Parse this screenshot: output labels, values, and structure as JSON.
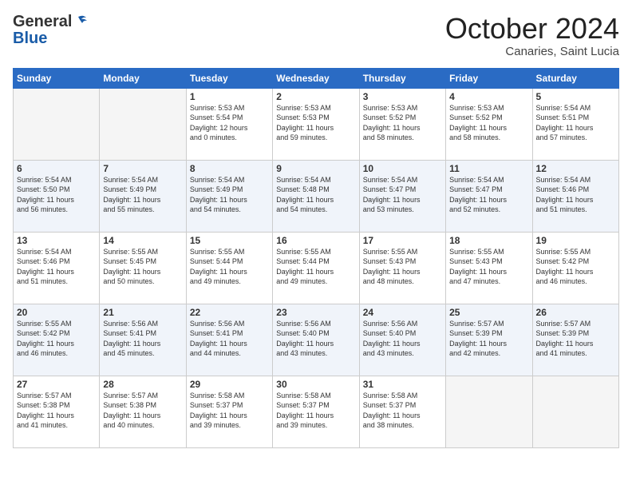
{
  "header": {
    "logo_general": "General",
    "logo_blue": "Blue",
    "month": "October 2024",
    "location": "Canaries, Saint Lucia"
  },
  "days_of_week": [
    "Sunday",
    "Monday",
    "Tuesday",
    "Wednesday",
    "Thursday",
    "Friday",
    "Saturday"
  ],
  "weeks": [
    [
      {
        "num": "",
        "info": ""
      },
      {
        "num": "",
        "info": ""
      },
      {
        "num": "1",
        "info": "Sunrise: 5:53 AM\nSunset: 5:54 PM\nDaylight: 12 hours\nand 0 minutes."
      },
      {
        "num": "2",
        "info": "Sunrise: 5:53 AM\nSunset: 5:53 PM\nDaylight: 11 hours\nand 59 minutes."
      },
      {
        "num": "3",
        "info": "Sunrise: 5:53 AM\nSunset: 5:52 PM\nDaylight: 11 hours\nand 58 minutes."
      },
      {
        "num": "4",
        "info": "Sunrise: 5:53 AM\nSunset: 5:52 PM\nDaylight: 11 hours\nand 58 minutes."
      },
      {
        "num": "5",
        "info": "Sunrise: 5:54 AM\nSunset: 5:51 PM\nDaylight: 11 hours\nand 57 minutes."
      }
    ],
    [
      {
        "num": "6",
        "info": "Sunrise: 5:54 AM\nSunset: 5:50 PM\nDaylight: 11 hours\nand 56 minutes."
      },
      {
        "num": "7",
        "info": "Sunrise: 5:54 AM\nSunset: 5:49 PM\nDaylight: 11 hours\nand 55 minutes."
      },
      {
        "num": "8",
        "info": "Sunrise: 5:54 AM\nSunset: 5:49 PM\nDaylight: 11 hours\nand 54 minutes."
      },
      {
        "num": "9",
        "info": "Sunrise: 5:54 AM\nSunset: 5:48 PM\nDaylight: 11 hours\nand 54 minutes."
      },
      {
        "num": "10",
        "info": "Sunrise: 5:54 AM\nSunset: 5:47 PM\nDaylight: 11 hours\nand 53 minutes."
      },
      {
        "num": "11",
        "info": "Sunrise: 5:54 AM\nSunset: 5:47 PM\nDaylight: 11 hours\nand 52 minutes."
      },
      {
        "num": "12",
        "info": "Sunrise: 5:54 AM\nSunset: 5:46 PM\nDaylight: 11 hours\nand 51 minutes."
      }
    ],
    [
      {
        "num": "13",
        "info": "Sunrise: 5:54 AM\nSunset: 5:46 PM\nDaylight: 11 hours\nand 51 minutes."
      },
      {
        "num": "14",
        "info": "Sunrise: 5:55 AM\nSunset: 5:45 PM\nDaylight: 11 hours\nand 50 minutes."
      },
      {
        "num": "15",
        "info": "Sunrise: 5:55 AM\nSunset: 5:44 PM\nDaylight: 11 hours\nand 49 minutes."
      },
      {
        "num": "16",
        "info": "Sunrise: 5:55 AM\nSunset: 5:44 PM\nDaylight: 11 hours\nand 49 minutes."
      },
      {
        "num": "17",
        "info": "Sunrise: 5:55 AM\nSunset: 5:43 PM\nDaylight: 11 hours\nand 48 minutes."
      },
      {
        "num": "18",
        "info": "Sunrise: 5:55 AM\nSunset: 5:43 PM\nDaylight: 11 hours\nand 47 minutes."
      },
      {
        "num": "19",
        "info": "Sunrise: 5:55 AM\nSunset: 5:42 PM\nDaylight: 11 hours\nand 46 minutes."
      }
    ],
    [
      {
        "num": "20",
        "info": "Sunrise: 5:55 AM\nSunset: 5:42 PM\nDaylight: 11 hours\nand 46 minutes."
      },
      {
        "num": "21",
        "info": "Sunrise: 5:56 AM\nSunset: 5:41 PM\nDaylight: 11 hours\nand 45 minutes."
      },
      {
        "num": "22",
        "info": "Sunrise: 5:56 AM\nSunset: 5:41 PM\nDaylight: 11 hours\nand 44 minutes."
      },
      {
        "num": "23",
        "info": "Sunrise: 5:56 AM\nSunset: 5:40 PM\nDaylight: 11 hours\nand 43 minutes."
      },
      {
        "num": "24",
        "info": "Sunrise: 5:56 AM\nSunset: 5:40 PM\nDaylight: 11 hours\nand 43 minutes."
      },
      {
        "num": "25",
        "info": "Sunrise: 5:57 AM\nSunset: 5:39 PM\nDaylight: 11 hours\nand 42 minutes."
      },
      {
        "num": "26",
        "info": "Sunrise: 5:57 AM\nSunset: 5:39 PM\nDaylight: 11 hours\nand 41 minutes."
      }
    ],
    [
      {
        "num": "27",
        "info": "Sunrise: 5:57 AM\nSunset: 5:38 PM\nDaylight: 11 hours\nand 41 minutes."
      },
      {
        "num": "28",
        "info": "Sunrise: 5:57 AM\nSunset: 5:38 PM\nDaylight: 11 hours\nand 40 minutes."
      },
      {
        "num": "29",
        "info": "Sunrise: 5:58 AM\nSunset: 5:37 PM\nDaylight: 11 hours\nand 39 minutes."
      },
      {
        "num": "30",
        "info": "Sunrise: 5:58 AM\nSunset: 5:37 PM\nDaylight: 11 hours\nand 39 minutes."
      },
      {
        "num": "31",
        "info": "Sunrise: 5:58 AM\nSunset: 5:37 PM\nDaylight: 11 hours\nand 38 minutes."
      },
      {
        "num": "",
        "info": ""
      },
      {
        "num": "",
        "info": ""
      }
    ]
  ]
}
